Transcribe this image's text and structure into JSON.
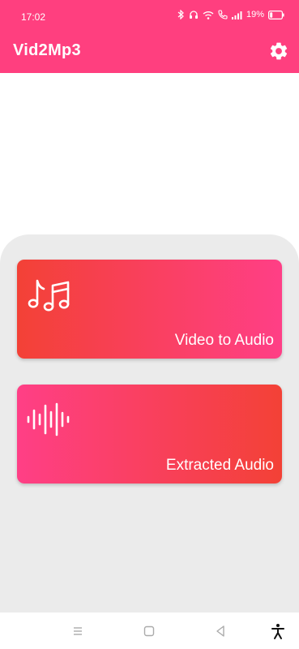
{
  "status": {
    "time": "17:02",
    "battery": "19%"
  },
  "app": {
    "title": "Vid2Mp3"
  },
  "icons": {
    "settings": "gear-icon",
    "card1": "music-notes-icon",
    "card2": "audio-waveform-icon"
  },
  "cards": [
    {
      "label": "Video to Audio"
    },
    {
      "label": "Extracted Audio"
    }
  ],
  "colors": {
    "accent": "#ff3f7f",
    "card_red": "#f34136",
    "card_pink": "#ff3f86",
    "panel": "#ebebeb"
  }
}
